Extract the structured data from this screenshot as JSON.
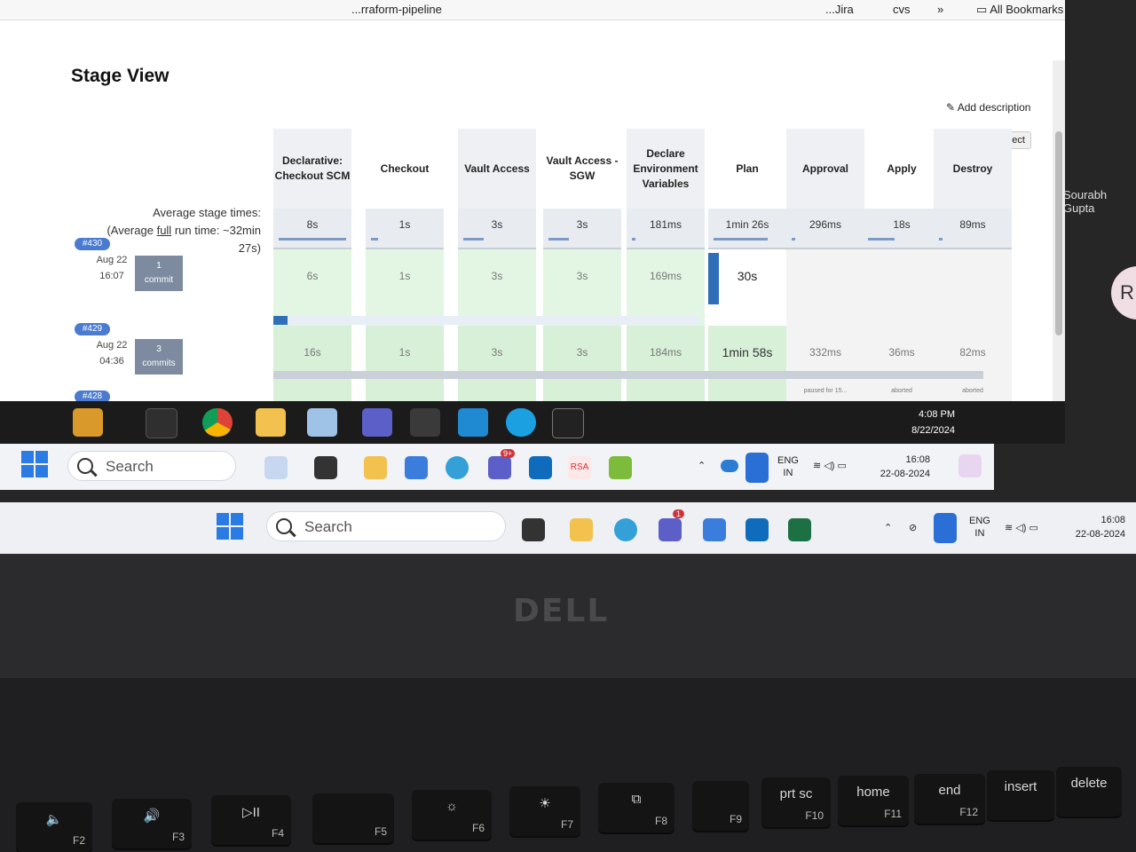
{
  "browser": {
    "job_title": "...rraform-pipeline",
    "bookmarks": [
      "...Jira",
      "cvs",
      "»",
      "All Bookmarks"
    ],
    "page_title": "Stage View",
    "add_description": "Add description",
    "disable_project": "Disable Project",
    "average": {
      "line1": "Average stage times:",
      "line2_pre": "(Average ",
      "line2_link": "full",
      "line2_post": " run time: ~32min",
      "line3": "27s)"
    },
    "stages": [
      {
        "name": "Declarative: Checkout SCM",
        "avg": "8s",
        "avg_fill": 1.0,
        "b430": "6s",
        "b429": "16s"
      },
      {
        "name": "Checkout",
        "avg": "1s",
        "avg_fill": 0.1,
        "b430": "1s",
        "b429": "1s"
      },
      {
        "name": "Vault Access",
        "avg": "3s",
        "avg_fill": 0.3,
        "b430": "3s",
        "b429": "3s"
      },
      {
        "name": "Vault Access - SGW",
        "avg": "3s",
        "avg_fill": 0.3,
        "b430": "3s",
        "b429": "3s"
      },
      {
        "name": "Declare Environment Variables",
        "avg": "181ms",
        "avg_fill": 0.05,
        "b430": "169ms",
        "b429": "184ms"
      },
      {
        "name": "Plan",
        "avg": "1min 26s",
        "avg_fill": 0.8,
        "b430": "30s",
        "b429": "1min 58s"
      },
      {
        "name": "Approval",
        "avg": "296ms",
        "avg_fill": 0.05,
        "b430": "",
        "b429": "332ms",
        "b429_note": "paused for 15..."
      },
      {
        "name": "Apply",
        "avg": "18s",
        "avg_fill": 0.4,
        "b430": "",
        "b429": "36ms",
        "b429_note": "aborted"
      },
      {
        "name": "Destroy",
        "avg": "89ms",
        "avg_fill": 0.05,
        "b430": "",
        "b429": "82ms",
        "b429_note": "aborted"
      }
    ],
    "builds": [
      {
        "id": "#430",
        "date": "Aug 22",
        "time": "16:07",
        "commits_count": "1",
        "commits_label": "commit"
      },
      {
        "id": "#429",
        "date": "Aug 22",
        "time": "04:36",
        "commits_count": "3",
        "commits_label": "commits"
      },
      {
        "id": "#428"
      }
    ],
    "side_user": "Sourabh Gupta",
    "side_avatar": "R"
  },
  "remote_taskbar": {
    "time": "4:08 PM",
    "date": "8/22/2024"
  },
  "taskbar1": {
    "search_placeholder": "Search",
    "lang_line1": "ENG",
    "lang_line2": "IN",
    "time": "16:08",
    "date": "22-08-2024",
    "badge": "9+",
    "rsa_label": "RSA"
  },
  "taskbar2": {
    "search_placeholder": "Search",
    "lang_line1": "ENG",
    "lang_line2": "IN",
    "time": "16:08",
    "date": "22-08-2024",
    "badge": "1"
  },
  "laptop": {
    "brand": "DELL",
    "keys": [
      {
        "fn": "F2",
        "label": "🔈"
      },
      {
        "fn": "F3",
        "label": "🔊"
      },
      {
        "fn": "F4",
        "label": "▷II"
      },
      {
        "fn": "F5",
        "label": ""
      },
      {
        "fn": "F6",
        "label": "☼"
      },
      {
        "fn": "F7",
        "label": "☀"
      },
      {
        "fn": "F8",
        "label": "⧉"
      },
      {
        "fn": "F9",
        "label": ""
      },
      {
        "fn": "F10",
        "label": "prt sc"
      },
      {
        "fn": "F11",
        "label": "home"
      },
      {
        "fn": "F12",
        "label": "end"
      },
      {
        "fn": "",
        "label": "insert"
      },
      {
        "fn": "",
        "label": "delete"
      }
    ]
  }
}
